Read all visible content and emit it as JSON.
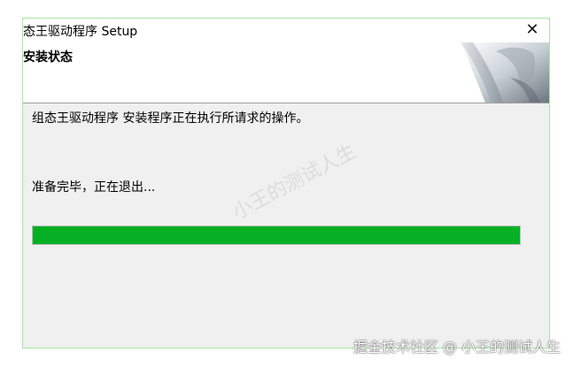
{
  "window": {
    "title": "态王驱动程序 Setup",
    "close_glyph": "✕"
  },
  "header": {
    "title": "安装状态"
  },
  "body": {
    "message": "组态王驱动程序 安装程序正在执行所请求的操作。",
    "status": "准备完毕，正在退出..."
  },
  "progress": {
    "fraction": 1.0,
    "color": "#06b025"
  },
  "watermark": {
    "text": "小王的测试人生",
    "footer": "掘金技术社区 @ 小王的测试人生"
  },
  "colors": {
    "window_border": "#a8e6a1",
    "dialog_background": "#f0f0f0",
    "header_background": "#ffffff"
  },
  "icons": {
    "close": "close-icon",
    "header_graphic": "page-curl-graphic"
  }
}
